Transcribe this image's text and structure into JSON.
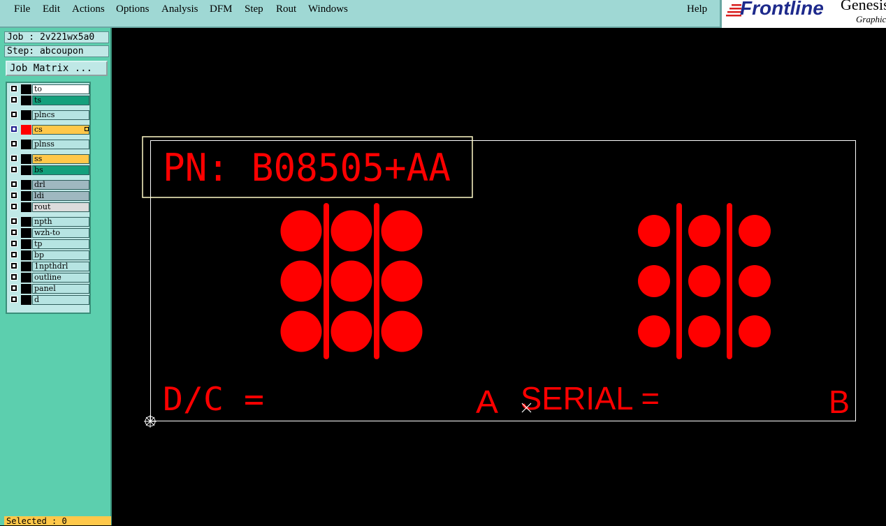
{
  "menubar": {
    "items": [
      {
        "label": "File"
      },
      {
        "label": "Edit"
      },
      {
        "label": "Actions"
      },
      {
        "label": "Options"
      },
      {
        "label": "Analysis"
      },
      {
        "label": "DFM"
      },
      {
        "label": "Step"
      },
      {
        "label": "Rout"
      },
      {
        "label": "Windows"
      }
    ],
    "help_label": "Help"
  },
  "brand": {
    "logo_text": "Frontline",
    "product_text": "Genesis",
    "sub_text": "Graphic"
  },
  "job_panel": {
    "job_line": "Job : 2v221wx5a0",
    "step_line": "Step: abcoupon",
    "job_matrix_label": "Job Matrix ..."
  },
  "layers": [
    {
      "name": "to",
      "color": "#ffffff"
    },
    {
      "name": "ts",
      "color": "#14a07c"
    },
    {
      "name": "plncs",
      "color": "#b6e4e2"
    },
    {
      "name": "cs",
      "color": "#ffc84a",
      "active": true,
      "display_color": "#ff0000"
    },
    {
      "name": "plnss",
      "color": "#b6e4e2"
    },
    {
      "name": "ss",
      "color": "#ffc84a"
    },
    {
      "name": "bs",
      "color": "#14a07c"
    },
    {
      "name": "drl",
      "color": "#9fb8c0"
    },
    {
      "name": "ldi",
      "color": "#9fb8c0"
    },
    {
      "name": "rout",
      "color": "#dcdcdc"
    },
    {
      "name": "npth",
      "color": "#b6e4e2"
    },
    {
      "name": "wzh-to",
      "color": "#b6e4e2"
    },
    {
      "name": "tp",
      "color": "#b6e4e2"
    },
    {
      "name": "bp",
      "color": "#b6e4e2"
    },
    {
      "name": "1npthdrl",
      "color": "#b6e4e2"
    },
    {
      "name": "outline",
      "color": "#b6e4e2"
    },
    {
      "name": "panel",
      "color": "#b6e4e2"
    },
    {
      "name": "d",
      "color": "#b6e4e2"
    }
  ],
  "status": {
    "selected_text": "Selected : 0"
  },
  "canvas": {
    "pn_text": "PN: B08505+AA",
    "dc_text": "D/C =",
    "label_a": "A",
    "serial_text": "SERIAL =",
    "label_b": "B",
    "feature_color": "#ff0000",
    "profile_color": "#ffffff",
    "highlight_color": "#fffbc8"
  }
}
